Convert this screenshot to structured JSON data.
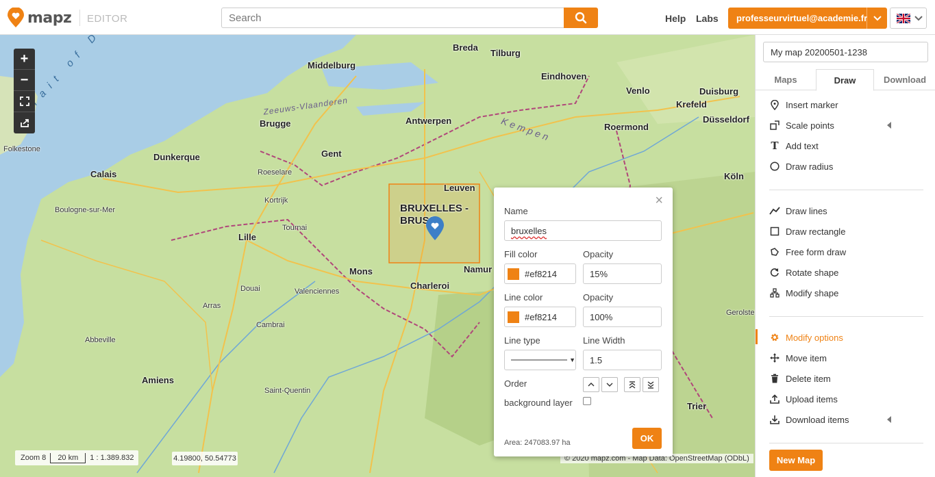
{
  "header": {
    "logo_text": "mapz",
    "editor_label": "EDITOR",
    "search_placeholder": "Search",
    "help_label": "Help",
    "labs_label": "Labs",
    "user_email": "professeurvirtuel@academie.fr",
    "language": "en-GB"
  },
  "map": {
    "zoom_in": "+",
    "zoom_out": "−",
    "scale": {
      "zoom": "Zoom 8",
      "distance": "20 km",
      "ratio": "1 : 1.389.832"
    },
    "coordinates": "4.19800, 50.54773",
    "credits": "© 2020 mapz.com - Map Data: OpenStreetMap (ODbL)",
    "places": {
      "bruxelles1": "BRUXELLES -",
      "bruxelles2": "BRUSS",
      "antwerpen": "Antwerpen",
      "gent": "Gent",
      "brugge": "Brugge",
      "lille": "Lille",
      "charleroi": "Charleroi",
      "namur": "Namur",
      "mons": "Mons",
      "leuven": "Leuven",
      "calais": "Calais",
      "dunkerque": "Dunkerque",
      "amiens": "Amiens",
      "arras": "Arras",
      "tilburg": "Tilburg",
      "eindhoven": "Eindhoven",
      "breda": "Breda",
      "middelburg": "Middelburg",
      "roermond": "Roermond",
      "krefeld": "Krefeld",
      "dusseldorf": "Düsseldorf",
      "duisburg": "Duisburg",
      "venlo": "Venlo",
      "koln": "Köln",
      "aachen_region": "Kempen",
      "valenciennes": "Valenciennes",
      "douai": "Douai",
      "cambrai": "Cambrai",
      "tournai": "Tournai",
      "kortrijk": "Kortrijk",
      "roeselare": "Roeselare",
      "oostende_region": "Zeeuws-Vlaanderen",
      "boulogne": "Boulogne-sur-Mer",
      "abbeville": "Abbeville",
      "saint_quentin": "Saint-Quentin",
      "dover": "Strait of Dover",
      "folkestone": "Folkestone",
      "trier": "Trier",
      "gerolstein": "Gerolstein"
    }
  },
  "popup": {
    "name_label": "Name",
    "name_value": "bruxelles",
    "fill_color_label": "Fill color",
    "fill_color_value": "#ef8214",
    "fill_opacity_label": "Opacity",
    "fill_opacity_value": "15%",
    "line_color_label": "Line color",
    "line_color_value": "#ef8214",
    "line_opacity_label": "Opacity",
    "line_opacity_value": "100%",
    "line_type_label": "Line type",
    "line_width_label": "Line Width",
    "line_width_value": "1.5",
    "order_label": "Order",
    "background_layer_label": "background layer",
    "area": "Area: 247083.97 ha",
    "ok_label": "OK"
  },
  "sidebar": {
    "map_title": "My map 20200501-1238",
    "tabs": [
      "Maps",
      "Draw",
      "Download"
    ],
    "items": [
      {
        "label": "Insert marker",
        "icon": "marker-icon"
      },
      {
        "label": "Scale points",
        "icon": "scale-points-icon"
      },
      {
        "label": "Add text",
        "icon": "text-icon"
      },
      {
        "label": "Draw radius",
        "icon": "circle-icon"
      },
      {
        "label": "Draw lines",
        "icon": "line-icon"
      },
      {
        "label": "Draw rectangle",
        "icon": "rectangle-icon"
      },
      {
        "label": "Free form draw",
        "icon": "freeform-icon"
      },
      {
        "label": "Rotate shape",
        "icon": "rotate-icon"
      },
      {
        "label": "Modify shape",
        "icon": "modify-shape-icon"
      },
      {
        "label": "Modify options",
        "icon": "gear-icon"
      },
      {
        "label": "Move item",
        "icon": "move-icon"
      },
      {
        "label": "Delete item",
        "icon": "trash-icon"
      },
      {
        "label": "Upload items",
        "icon": "upload-icon"
      },
      {
        "label": "Download items",
        "icon": "download-icon"
      }
    ],
    "new_map_label": "New Map"
  },
  "colors": {
    "accent": "#ef8214",
    "sea": "#a9cde6",
    "land": "#c7dfa0"
  }
}
